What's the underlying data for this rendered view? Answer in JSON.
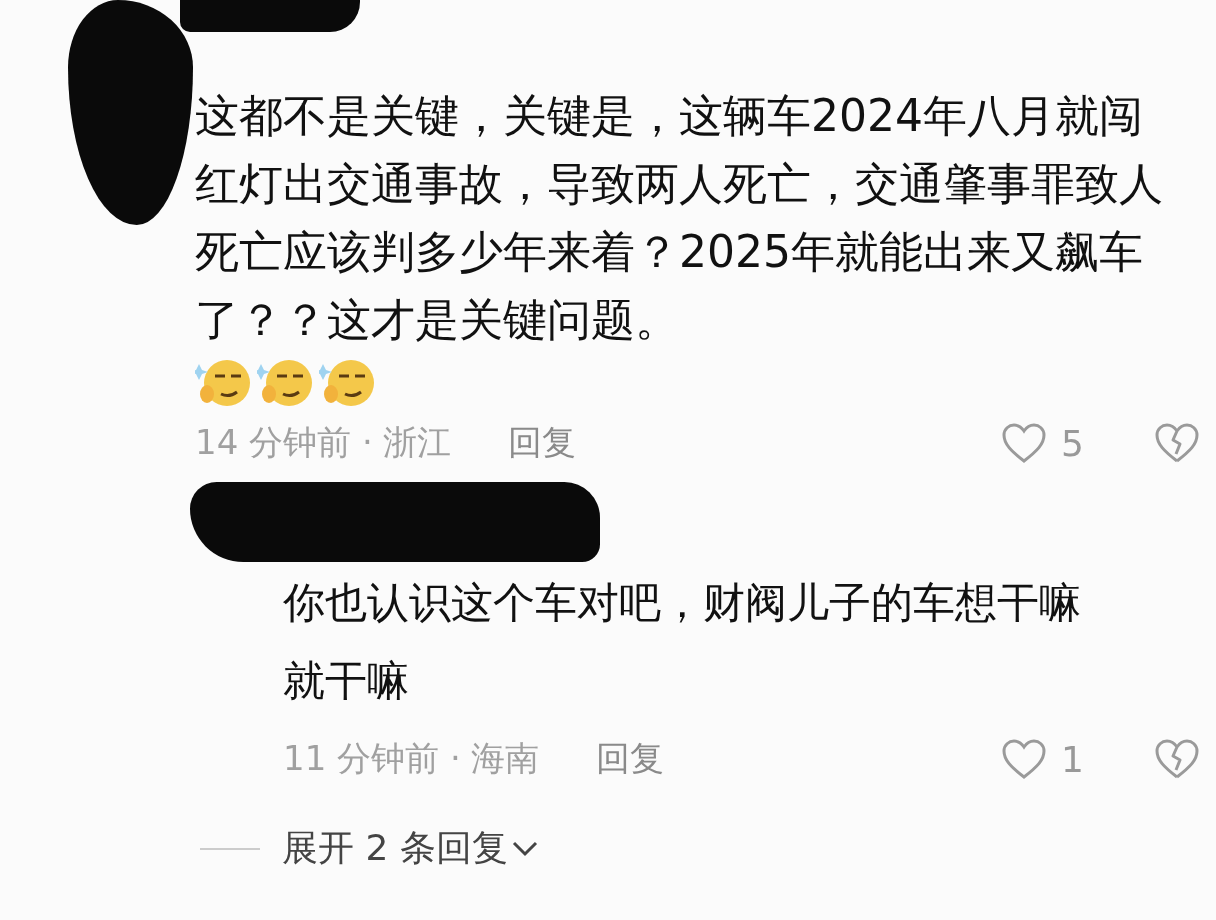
{
  "comments": [
    {
      "author_redacted": true,
      "avatar_redacted": true,
      "text": "这都不是关键，关键是，这辆车2024年八月就闯红灯出交通事故，导致两人死亡，交通肇事罪致人死亡应该判多少年来着？2025年就能出来又飙车了？？这才是关键问题。",
      "emojis": [
        {
          "kind": "smirk"
        },
        {
          "kind": "smirk"
        },
        {
          "kind": "smirk"
        }
      ],
      "time": "14 分钟前 · 浙江",
      "reply_label": "回复",
      "likes": "5",
      "liked": false,
      "replies": [
        {
          "author_redacted": true,
          "text": "你也认识这个车对吧，财阀儿子的车想干嘛就干嘛",
          "time": "11 分钟前 · 海南",
          "reply_label": "回复",
          "likes": "1",
          "liked": false
        }
      ],
      "expand_label": "展开 2 条回复"
    }
  ]
}
